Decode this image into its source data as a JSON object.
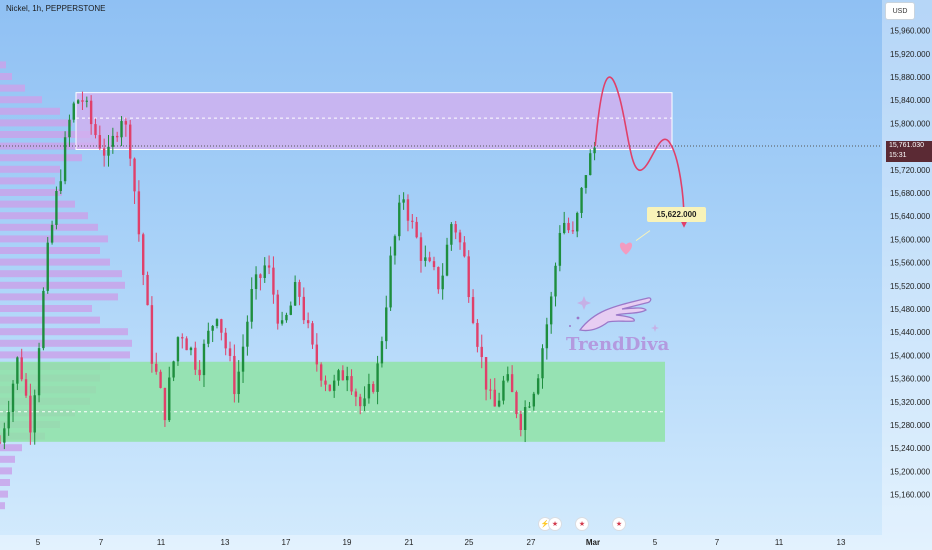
{
  "header": {
    "title": "Nickel, 1h, PEPPERSTONE",
    "currency": "USD"
  },
  "price_tag": {
    "price": "15,761.030",
    "countdown": "15:31"
  },
  "annotation": {
    "target": "15,622.000"
  },
  "logo": {
    "text": "TrendDiva"
  },
  "events": [
    {
      "icon": "flash-icon"
    },
    {
      "icon": "us-flag-icon"
    },
    {
      "icon": "us-flag-icon"
    },
    {
      "icon": "us-flag-icon"
    }
  ],
  "colors": {
    "up": "#1e8e3e",
    "down": "#e0406a",
    "resistance": "#d3b0f0",
    "support": "#8fe3a6",
    "projection": "#e0406a"
  },
  "chart_data": {
    "type": "candlestick",
    "symbol": "Nickel",
    "timeframe": "1h",
    "exchange": "PEPPERSTONE",
    "ylim": [
      15120,
      15990
    ],
    "y_ticks": [
      15160,
      15200,
      15240,
      15280,
      15320,
      15360,
      15400,
      15440,
      15480,
      15520,
      15560,
      15600,
      15640,
      15680,
      15720,
      15760,
      15800,
      15840,
      15880,
      15920,
      15960
    ],
    "y_tick_labels": [
      "15,160.000",
      "15,200.000",
      "15,240.000",
      "15,280.000",
      "15,320.000",
      "15,360.000",
      "15,400.000",
      "15,440.000",
      "15,480.000",
      "15,520.000",
      "15,560.000",
      "15,600.000",
      "15,640.000",
      "15,680.000",
      "15,720.000",
      "15,760.000",
      "15,800.000",
      "15,840.000",
      "15,880.000",
      "15,920.000",
      "15,960.000"
    ],
    "x_ticks": [
      "5",
      "7",
      "11",
      "13",
      "17",
      "19",
      "21",
      "25",
      "27",
      "Mar",
      "5",
      "7",
      "11",
      "13"
    ],
    "last_price": 15761.03,
    "resistance_zone": [
      15755,
      15853
    ],
    "support_zone": [
      15251,
      15389
    ],
    "target_price": 15622,
    "price_path": [
      {
        "d": 0,
        "p": 15250
      },
      {
        "d": 0.6,
        "p": 15400
      },
      {
        "d": 1.0,
        "p": 15280
      },
      {
        "d": 1.5,
        "p": 15560
      },
      {
        "d": 1.9,
        "p": 15700
      },
      {
        "d": 2.3,
        "p": 15820
      },
      {
        "d": 2.6,
        "p": 15850
      },
      {
        "d": 3.0,
        "p": 15790
      },
      {
        "d": 3.5,
        "p": 15740
      },
      {
        "d": 3.9,
        "p": 15820
      },
      {
        "d": 4.2,
        "p": 15760
      },
      {
        "d": 4.5,
        "p": 15600
      },
      {
        "d": 4.9,
        "p": 15400
      },
      {
        "d": 5.3,
        "p": 15300
      },
      {
        "d": 5.8,
        "p": 15450
      },
      {
        "d": 6.4,
        "p": 15380
      },
      {
        "d": 7.0,
        "p": 15480
      },
      {
        "d": 7.6,
        "p": 15340
      },
      {
        "d": 8.1,
        "p": 15500
      },
      {
        "d": 8.6,
        "p": 15560
      },
      {
        "d": 9.1,
        "p": 15440
      },
      {
        "d": 9.6,
        "p": 15520
      },
      {
        "d": 10.1,
        "p": 15400
      },
      {
        "d": 10.7,
        "p": 15340
      },
      {
        "d": 11.2,
        "p": 15380
      },
      {
        "d": 11.7,
        "p": 15300
      },
      {
        "d": 12.2,
        "p": 15380
      },
      {
        "d": 12.6,
        "p": 15560
      },
      {
        "d": 13.0,
        "p": 15680
      },
      {
        "d": 13.3,
        "p": 15620
      },
      {
        "d": 13.7,
        "p": 15560
      },
      {
        "d": 14.2,
        "p": 15520
      },
      {
        "d": 14.6,
        "p": 15640
      },
      {
        "d": 15.0,
        "p": 15560
      },
      {
        "d": 15.5,
        "p": 15400
      },
      {
        "d": 15.9,
        "p": 15300
      },
      {
        "d": 16.3,
        "p": 15360
      },
      {
        "d": 16.8,
        "p": 15290
      },
      {
        "d": 17.3,
        "p": 15360
      },
      {
        "d": 17.8,
        "p": 15500
      },
      {
        "d": 18.1,
        "p": 15640
      },
      {
        "d": 18.5,
        "p": 15600
      },
      {
        "d": 18.9,
        "p": 15720
      },
      {
        "d": 19.2,
        "p": 15761
      }
    ],
    "volume_profile": [
      {
        "p": 15140,
        "w": 5
      },
      {
        "p": 15160,
        "w": 8
      },
      {
        "p": 15180,
        "w": 10
      },
      {
        "p": 15200,
        "w": 12
      },
      {
        "p": 15220,
        "w": 15
      },
      {
        "p": 15240,
        "w": 22
      },
      {
        "p": 15260,
        "w": 45
      },
      {
        "p": 15280,
        "w": 60
      },
      {
        "p": 15300,
        "w": 75
      },
      {
        "p": 15320,
        "w": 90
      },
      {
        "p": 15340,
        "w": 96
      },
      {
        "p": 15360,
        "w": 100
      },
      {
        "p": 15380,
        "w": 110
      },
      {
        "p": 15400,
        "w": 130
      },
      {
        "p": 15420,
        "w": 132
      },
      {
        "p": 15440,
        "w": 128
      },
      {
        "p": 15460,
        "w": 100
      },
      {
        "p": 15480,
        "w": 92
      },
      {
        "p": 15500,
        "w": 118
      },
      {
        "p": 15520,
        "w": 125
      },
      {
        "p": 15540,
        "w": 122
      },
      {
        "p": 15560,
        "w": 110
      },
      {
        "p": 15580,
        "w": 100
      },
      {
        "p": 15600,
        "w": 108
      },
      {
        "p": 15620,
        "w": 98
      },
      {
        "p": 15640,
        "w": 88
      },
      {
        "p": 15660,
        "w": 75
      },
      {
        "p": 15680,
        "w": 62
      },
      {
        "p": 15700,
        "w": 55
      },
      {
        "p": 15720,
        "w": 60
      },
      {
        "p": 15740,
        "w": 82
      },
      {
        "p": 15760,
        "w": 96
      },
      {
        "p": 15780,
        "w": 90
      },
      {
        "p": 15800,
        "w": 72
      },
      {
        "p": 15820,
        "w": 60
      },
      {
        "p": 15840,
        "w": 42
      },
      {
        "p": 15860,
        "w": 25
      },
      {
        "p": 15880,
        "w": 12
      },
      {
        "p": 15900,
        "w": 6
      }
    ],
    "projection": [
      {
        "d": 19.2,
        "p": 15761
      },
      {
        "d": 19.8,
        "p": 15860
      },
      {
        "d": 20.6,
        "p": 15740
      },
      {
        "d": 21.4,
        "p": 15764
      },
      {
        "d": 22.0,
        "p": 15620
      }
    ]
  }
}
